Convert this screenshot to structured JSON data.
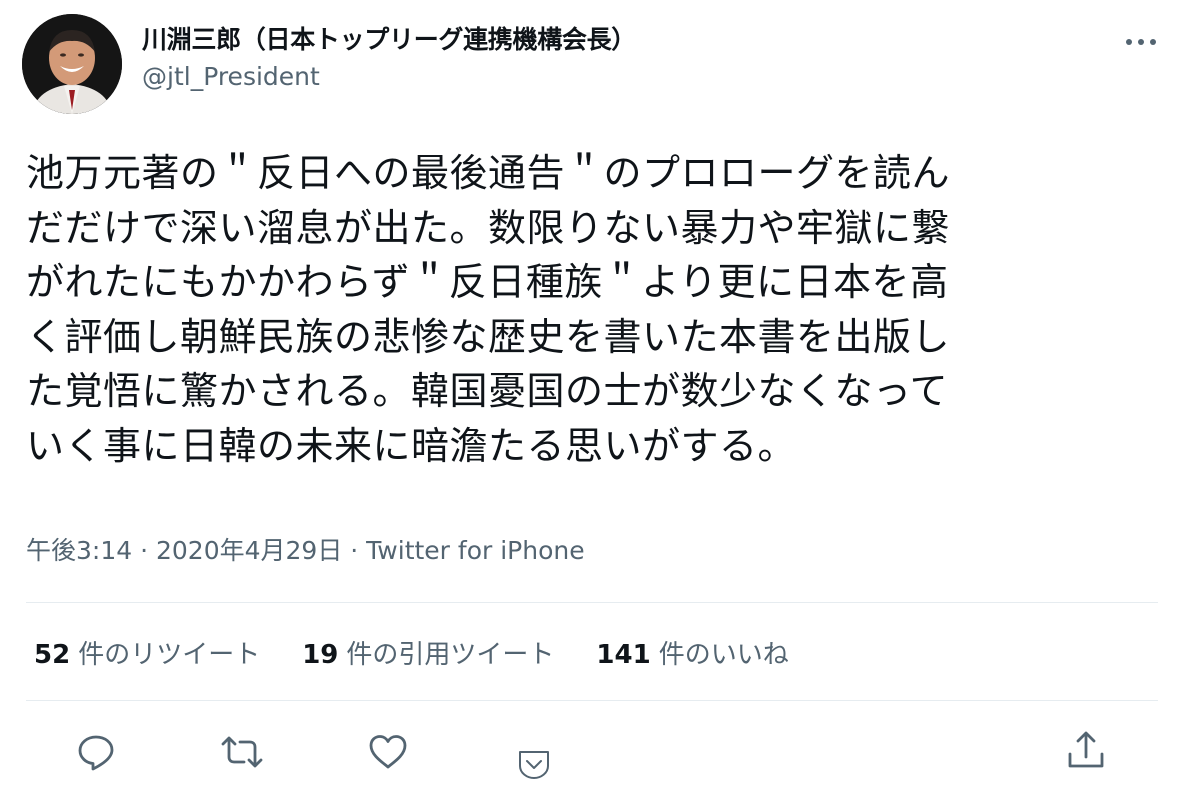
{
  "author": {
    "display_name": "川淵三郎（日本トップリーグ連携機構会長）",
    "handle": "@jtl_President"
  },
  "tweet": {
    "lines": [
      "池万元著の＂反日への最後通告＂のプロローグを読ん",
      "だだけで深い溜息が出た。数限りない暴力や牢獄に繋",
      "がれたにもかかわらず＂反日種族＂より更に日本を高",
      "く評価し朝鮮民族の悲惨な歴史を書いた本書を出版し",
      "た覚悟に驚かされる。韓国憂国の士が数少なくなって",
      "いく事に日韓の未来に暗澹たる思いがする。"
    ]
  },
  "meta": {
    "time": "午後3:14",
    "date": "2020年4月29日",
    "sep": " · ",
    "source": "Twitter for iPhone"
  },
  "stats": {
    "retweets": {
      "count": "52",
      "label": "件のリツイート"
    },
    "quotes": {
      "count": "19",
      "label": "件の引用ツイート"
    },
    "likes": {
      "count": "141",
      "label": "件のいいね"
    }
  },
  "icons": [
    "more-icon",
    "reply-icon",
    "retweet-icon",
    "like-icon",
    "bookmark-icon",
    "share-icon"
  ],
  "colors": {
    "text": "#0f1419",
    "secondary": "#536471",
    "divider": "#e6ecf0"
  }
}
